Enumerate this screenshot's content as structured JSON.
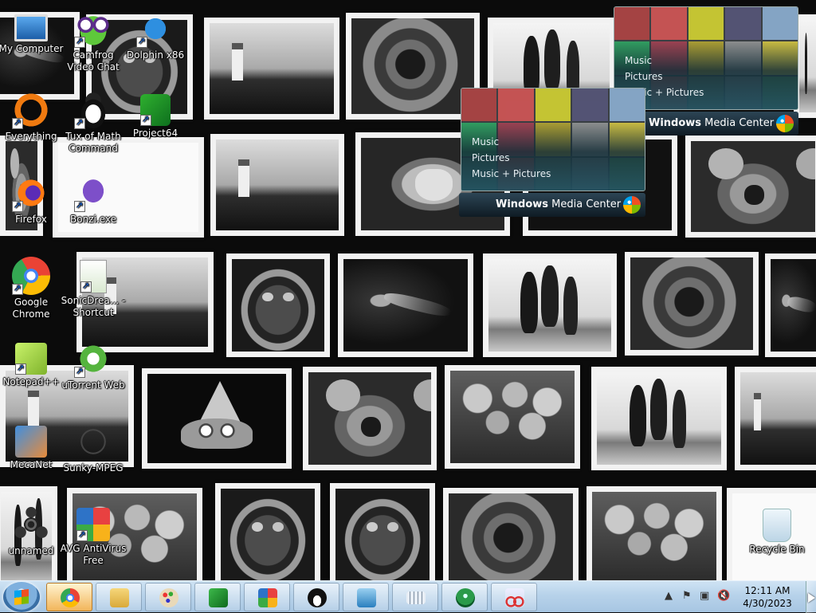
{
  "desktop": {
    "icons": [
      {
        "label": "My Computer",
        "glyph": "computer-icon"
      },
      {
        "label": "Camfrog Video Chat",
        "glyph": "camfrog-icon"
      },
      {
        "label": "Dolphin x86",
        "glyph": "dolphin-icon"
      },
      {
        "label": "Everything",
        "glyph": "everything-icon"
      },
      {
        "label": "Tux of Math Command",
        "glyph": "tux-icon"
      },
      {
        "label": "Project64",
        "glyph": "project64-icon"
      },
      {
        "label": "Firefox",
        "glyph": "firefox-icon"
      },
      {
        "label": "Bonzi.exe",
        "glyph": "bonzi-icon"
      },
      {
        "label": "Google Chrome",
        "glyph": "chrome-icon"
      },
      {
        "label": "SonicDrea... - Shortcut",
        "glyph": "sonic-icon"
      },
      {
        "label": "Notepad++",
        "glyph": "notepadpp-icon"
      },
      {
        "label": "uTorrent Web",
        "glyph": "utorrent-icon"
      },
      {
        "label": "MecaNet",
        "glyph": "mecanet-icon"
      },
      {
        "label": "Sunky-MPEG",
        "glyph": "sunky-icon"
      },
      {
        "label": "unnamed",
        "glyph": "fidget-spinner-icon"
      },
      {
        "label": "AVG AntiVirus Free",
        "glyph": "avg-icon"
      },
      {
        "label": "Recycle Bin",
        "glyph": "recycle-bin-icon"
      }
    ]
  },
  "wmc_widgets": [
    {
      "menu": [
        "Music",
        "Pictures",
        "Music + Pictures"
      ],
      "brand_bold": "Windows",
      "brand_rest": " Media Center"
    },
    {
      "menu": [
        "Music",
        "Pictures",
        "Music + Pictures"
      ],
      "brand_bold": "Windows",
      "brand_rest": " Media Center"
    }
  ],
  "taskbar": {
    "start_icon": "windows-start-orb-icon",
    "pinned": [
      {
        "name": "chrome",
        "icon": "chrome-icon",
        "active": true
      },
      {
        "name": "explorer",
        "icon": "folder-icon"
      },
      {
        "name": "paint",
        "icon": "palette-icon"
      },
      {
        "name": "project64",
        "icon": "project64-icon"
      },
      {
        "name": "avg",
        "icon": "avg-icon"
      },
      {
        "name": "tux",
        "icon": "tux-icon"
      },
      {
        "name": "installer",
        "icon": "download-icon"
      },
      {
        "name": "keyboard",
        "icon": "keyboard-icon"
      },
      {
        "name": "windows-media-center",
        "icon": "wmc-icon"
      },
      {
        "name": "snipping-tool",
        "icon": "scissors-icon"
      }
    ],
    "tray": {
      "time": "12:11 AM",
      "date": "4/30/2023",
      "icons": [
        "show-hidden-icons-icon",
        "action-center-flag-icon",
        "network-icon",
        "volume-muted-icon"
      ]
    }
  },
  "colors": {
    "taskbar": "#b7d2ea",
    "wallpaper": "#0b0b0b",
    "wmc_bar": "#2d4555"
  }
}
